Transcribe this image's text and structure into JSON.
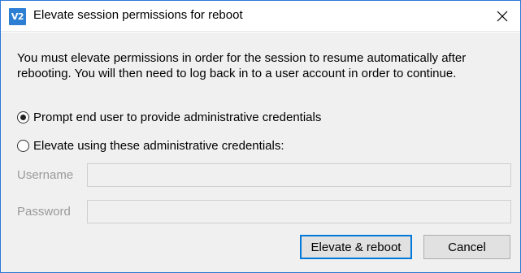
{
  "window": {
    "icon_text": "V2",
    "title": "Elevate session permissions for reboot",
    "close_glyph": "×"
  },
  "message": "You must elevate permissions in order for the session to resume automatically after rebooting. You will then need to log back in to a user account in order to continue.",
  "options": [
    {
      "label": "Prompt end user to provide administrative credentials",
      "selected": true
    },
    {
      "label": "Elevate using these administrative credentials:",
      "selected": false
    }
  ],
  "fields": {
    "username_label": "Username",
    "username_value": "",
    "password_label": "Password",
    "password_value": ""
  },
  "buttons": {
    "elevate_label": "Elevate & reboot",
    "cancel_label": "Cancel"
  },
  "colors": {
    "accent": "#0078d7",
    "icon_bg": "#2d7fd3",
    "dialog_bg": "#f0f0f0"
  }
}
